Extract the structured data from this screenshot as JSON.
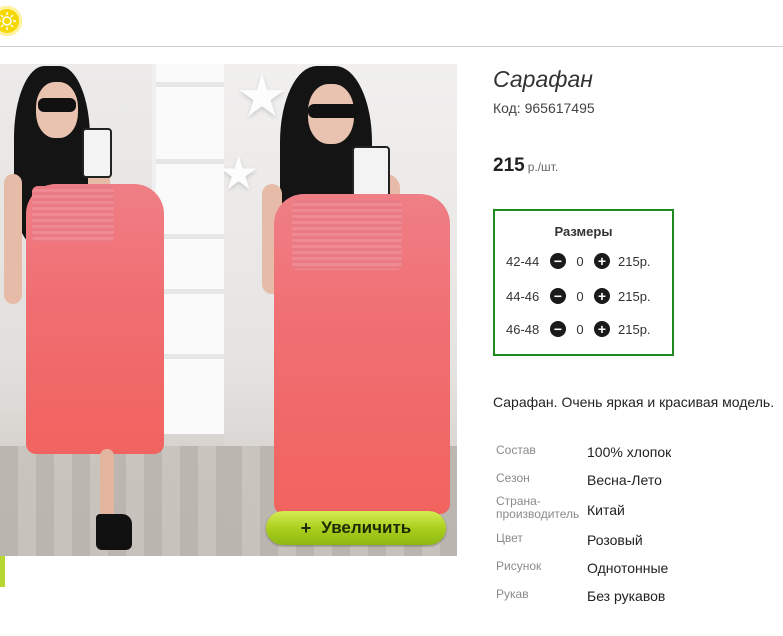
{
  "product": {
    "title": "Сарафан",
    "code": "Код: 965617495",
    "price": "215",
    "price_unit": "р./шт.",
    "zoom_button": "Увеличить",
    "zoom_plus": "+",
    "description": "Сарафан. Очень яркая и красивая модель."
  },
  "sizes": {
    "header": "Размеры",
    "rows": [
      {
        "size": "42-44",
        "qty": "0",
        "price": "215р."
      },
      {
        "size": "44-46",
        "qty": "0",
        "price": "215р."
      },
      {
        "size": "46-48",
        "qty": "0",
        "price": "215р."
      }
    ]
  },
  "properties": [
    {
      "key": "Состав",
      "value": "100% хлопок"
    },
    {
      "key": "Сезон",
      "value": "Весна-Лето"
    },
    {
      "key": "Страна-производитель",
      "value": "Китай"
    },
    {
      "key": "Цвет",
      "value": "Розовый"
    },
    {
      "key": "Рисунок",
      "value": "Однотонные"
    },
    {
      "key": "Рукав",
      "value": "Без рукавов"
    }
  ],
  "colors": {
    "accent_green": "#1f8a1f",
    "zoom_button": "#a7cc1b",
    "dress": "#f06f73",
    "logo": "#f5d800"
  },
  "icons": [
    "sun-logo-icon",
    "minus-icon",
    "plus-icon"
  ]
}
